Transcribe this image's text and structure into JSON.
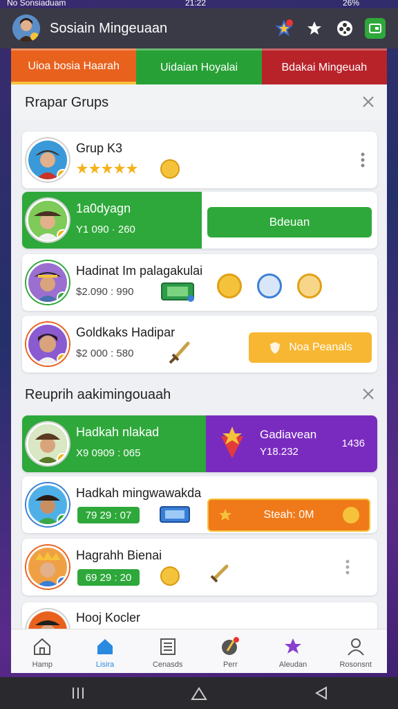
{
  "status": {
    "left": "No Sonsiaduam",
    "time": "21:22",
    "battery": "26%"
  },
  "app": {
    "title": "Sosiain Mingeuaan"
  },
  "tabs": [
    {
      "label": "Uioa bosia Haarah",
      "color": "#e8621e"
    },
    {
      "label": "Uidaian Hoyalai",
      "color": "#27a136"
    },
    {
      "label": "Bdakai Mingeuah",
      "color": "#b8232a"
    }
  ],
  "section1": {
    "title": "Rrapar Grups"
  },
  "cards": [
    {
      "name": "Grup K3",
      "sub": ""
    },
    {
      "name": "1a0dyagn",
      "sub": "Y1 090 · 260",
      "button": "Bdeuan"
    },
    {
      "name": "Hadinat Im palagakulai",
      "sub": "$2.090 : 990"
    },
    {
      "name": "Goldkaks Hadipar",
      "sub": "$2 000 : 580",
      "button": "Noa Peanals"
    }
  ],
  "section2": {
    "title": "Reuprih aakimingouaah"
  },
  "cards2": [
    {
      "name": "Hadkah nlakad",
      "sub": "X9 0909 : 065",
      "right_name": "Gadiavean",
      "right_sub": "Y18.232",
      "right_value": "1436"
    },
    {
      "name": "Hadkah mingwawakda",
      "sub": "79 29 : 07",
      "button": "Steah: 0M"
    },
    {
      "name": "Hagrahh Bienai",
      "sub": "69 29 : 20"
    },
    {
      "name": "Hooj Kocler",
      "sub": ""
    }
  ],
  "nav": [
    {
      "label": "Hamp",
      "icon": "home-icon"
    },
    {
      "label": "Lisira",
      "icon": "home-active-icon"
    },
    {
      "label": "Cenasds",
      "icon": "document-icon"
    },
    {
      "label": "Perr",
      "icon": "sword-icon"
    },
    {
      "label": "Aleudan",
      "icon": "star-icon"
    },
    {
      "label": "Rosonsnt",
      "icon": "profile-icon"
    }
  ],
  "colors": {
    "green": "#2ea83a",
    "purple": "#7a2bbf",
    "orange": "#f07a1a",
    "yellow": "#f7b733"
  }
}
